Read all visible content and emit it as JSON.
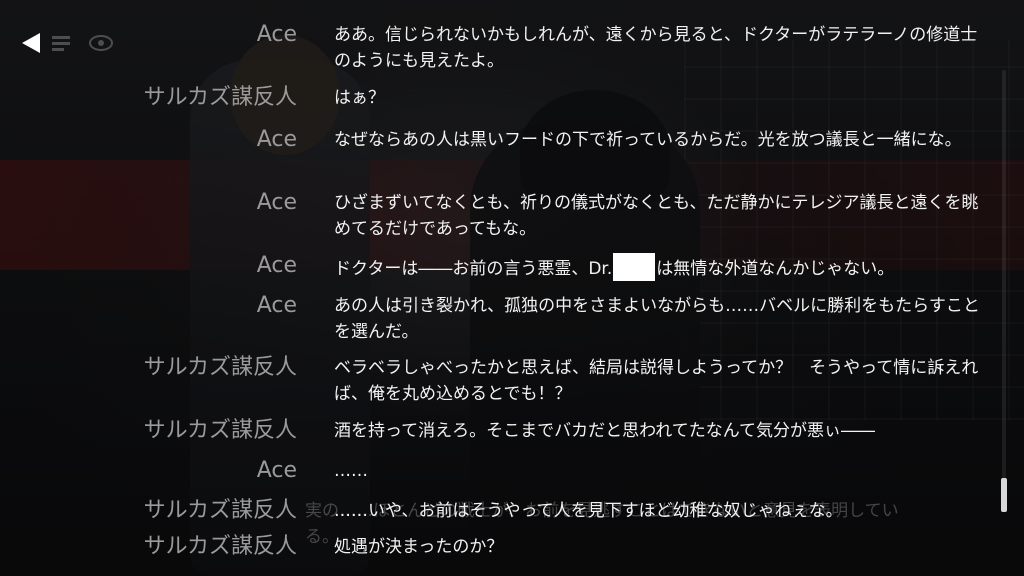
{
  "controls": {
    "back_icon": "back-arrow-icon"
  },
  "background_text": "実の……ほとんどの戦士が、お前を見逃すことはできないと意見を表明している。",
  "log": [
    {
      "speaker": "Ace",
      "text": "ああ。信じられないかもしれんが、遠くから見ると、ドクターがラテラーノの修道士のようにも見えたよ。"
    },
    {
      "speaker": "サルカズ謀反人",
      "text": "はぁ？"
    },
    {
      "speaker": "Ace",
      "text": "なぜならあの人は黒いフードの下で祈っているからだ。光を放つ議長と一緒にな。"
    },
    {
      "speaker": "Ace",
      "text": "ひざまずいてなくとも、祈りの儀式がなくとも、ただ静かにテレジア議長と遠くを眺めてるだけであってもな。"
    },
    {
      "speaker": "Ace",
      "text_before": "ドクターは――お前の言う悪霊、Dr.",
      "text_after": "は無情な外道なんかじゃない。"
    },
    {
      "speaker": "Ace",
      "text": "あの人は引き裂かれ、孤独の中をさまよいながらも……バベルに勝利をもたらすことを選んだ。"
    },
    {
      "speaker": "サルカズ謀反人",
      "text": "ベラベラしゃべったかと思えば、結局は説得しようってか？　そうやって情に訴えれば、俺を丸め込めるとでも！？"
    },
    {
      "speaker": "サルカズ謀反人",
      "text": "酒を持って消えろ。そこまでバカだと思われてたなんて気分が悪ぃ――"
    },
    {
      "speaker": "Ace",
      "text": "……"
    },
    {
      "speaker": "サルカズ謀反人",
      "text": "……いや、お前はそうやって人を見下すほど幼稚な奴じゃねぇな。"
    },
    {
      "speaker": "サルカズ謀反人",
      "text": "処遇が決まったのか？"
    }
  ]
}
